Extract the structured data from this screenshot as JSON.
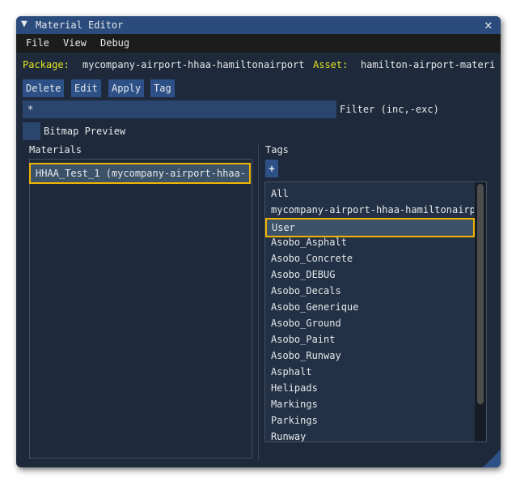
{
  "window": {
    "title": "Material Editor",
    "collapse_icon": "triangle-down",
    "close_icon": "close"
  },
  "menu": [
    "File",
    "View",
    "Debug"
  ],
  "package_label": "Package:",
  "package_value": "mycompany-airport-hhaa-hamiltonairport",
  "asset_label": "Asset:",
  "asset_value": "hamilton-airport-materi",
  "toolbar": {
    "delete": "Delete",
    "edit": "Edit",
    "apply": "Apply",
    "tag": "Tag"
  },
  "filter": {
    "value": "*",
    "label": "Filter (inc,-exc)"
  },
  "bitmap_preview": {
    "label": "Bitmap Preview",
    "checked": false
  },
  "materials": {
    "header": "Materials",
    "items": [
      "HHAA_Test_1 (mycompany-airport-hhaa-"
    ]
  },
  "tags": {
    "header": "Tags",
    "add_label": "+",
    "items": [
      "All",
      "mycompany-airport-hhaa-hamiltonairport",
      "User",
      "Asobo_Asphalt",
      "Asobo_Concrete",
      "Asobo_DEBUG",
      "Asobo_Decals",
      "Asobo_Generique",
      "Asobo_Ground",
      "Asobo_Paint",
      "Asobo_Runway",
      "Asphalt",
      "Helipads",
      "Markings",
      "Parkings",
      "Runway"
    ],
    "selected": "User"
  },
  "colors": {
    "accent": "#2d5186",
    "highlight": "#f0b400",
    "label": "#e7e620"
  }
}
